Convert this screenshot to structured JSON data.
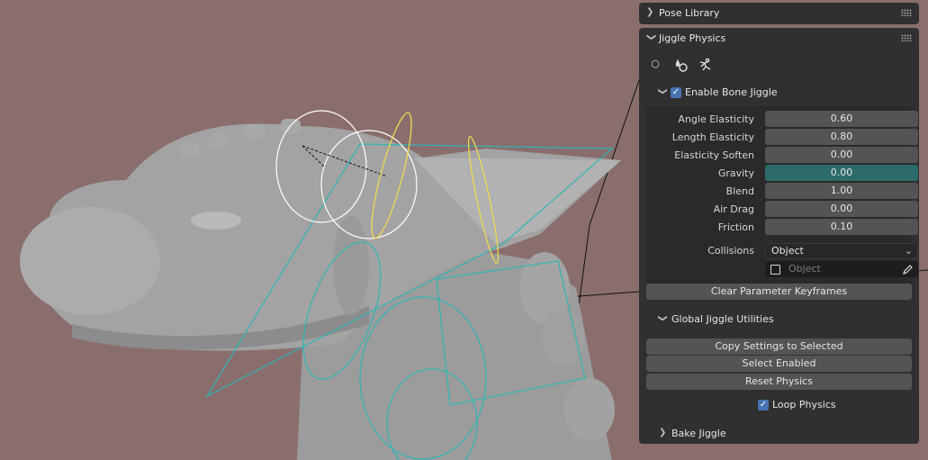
{
  "pose_library": {
    "title": "Pose Library"
  },
  "jiggle_physics": {
    "title": "Jiggle Physics",
    "enable": {
      "label": "Enable Bone Jiggle",
      "checked": true
    },
    "properties": [
      {
        "label": "Angle Elasticity",
        "value": "0.60"
      },
      {
        "label": "Length Elasticity",
        "value": "0.80"
      },
      {
        "label": "Elasticity Soften",
        "value": "0.00"
      },
      {
        "label": "Gravity",
        "value": "0.00"
      },
      {
        "label": "Blend",
        "value": "1.00"
      },
      {
        "label": "Air Drag",
        "value": "0.00"
      },
      {
        "label": "Friction",
        "value": "0.10"
      }
    ],
    "collisions": {
      "label": "Collisions",
      "value": "Object",
      "object_placeholder": "Object"
    },
    "clear_keyframes": "Clear Parameter Keyframes",
    "global": {
      "title": "Global Jiggle Utilities",
      "buttons": [
        "Copy Settings to Selected",
        "Select Enabled",
        "Reset Physics"
      ],
      "loop_physics": {
        "label": "Loop Physics",
        "checked": true
      }
    },
    "bake": {
      "title": "Bake Jiggle"
    }
  },
  "colors": {
    "accent": "#4772b3",
    "active_field": "#2d6a6a",
    "bone_highlight": "#f0d850",
    "bone_shape": "#2fb5b5"
  }
}
